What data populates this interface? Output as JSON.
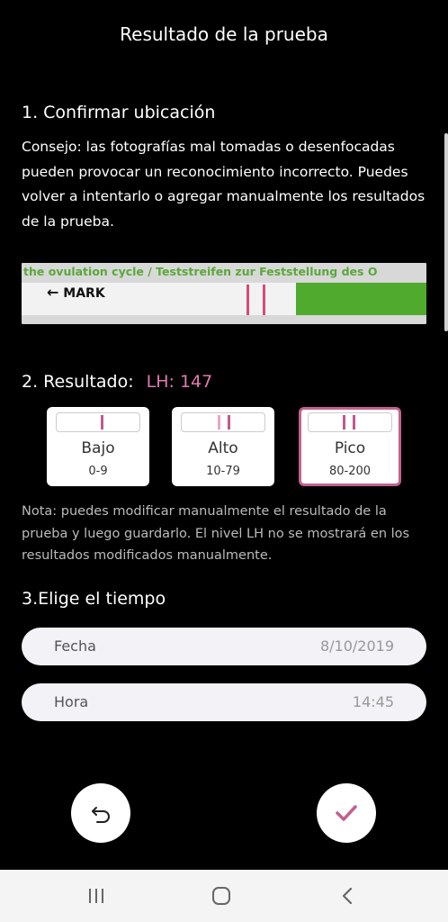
{
  "header": {
    "title": "Resultado de la prueba"
  },
  "section1": {
    "heading": "1. Confirmar ubicación",
    "tip": "Consejo: las fotografías mal tomadas o desenfocadas pueden provocar un reconocimiento incorrecto. Puedes volver a intentarlo o agregar manualmente los resultados de la prueba.",
    "strip_text": "the ovulation cycle / Teststreifen zur Feststellung des O",
    "strip_mark": "MARK"
  },
  "section2": {
    "heading": "2. Resultado:",
    "lh_value": "LH: 147",
    "cards": [
      {
        "label": "Bajo",
        "range": "0-9",
        "selected": false
      },
      {
        "label": "Alto",
        "range": "10-79",
        "selected": false
      },
      {
        "label": "Pico",
        "range": "80-200",
        "selected": true
      }
    ],
    "note": "Nota: puedes modificar manualmente el resultado de la prueba y luego guardarlo. El nivel LH no se mostrará en los resultados modificados manualmente."
  },
  "section3": {
    "heading": "3.Elige el tiempo",
    "date": {
      "label": "Fecha",
      "value": "8/10/2019"
    },
    "time": {
      "label": "Hora",
      "value": "14:45"
    }
  },
  "colors": {
    "accent": "#c2578f",
    "lh": "#e07ab0",
    "background": "#000000"
  },
  "icons": {
    "undo": "undo-icon",
    "confirm": "checkmark-icon",
    "recents": "recents-icon",
    "home": "home-icon",
    "back": "back-icon"
  }
}
